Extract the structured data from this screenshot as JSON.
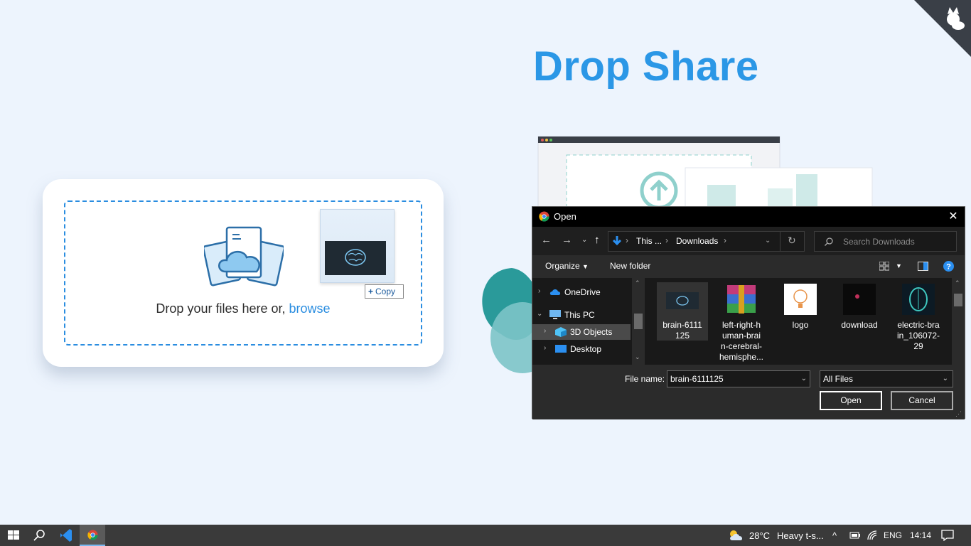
{
  "app": {
    "title": "Drop Share"
  },
  "dropzone": {
    "prompt": "Drop your files here or,",
    "browse_label": "browse",
    "drag_badge": "Copy"
  },
  "dialog": {
    "title": "Open",
    "breadcrumb": [
      "This ...",
      "Downloads"
    ],
    "search_placeholder": "Search Downloads",
    "toolbar": {
      "organize": "Organize",
      "new_folder": "New folder"
    },
    "nav_items": [
      {
        "label": "OneDrive",
        "icon": "cloud-icon"
      },
      {
        "label": "This PC",
        "icon": "computer-icon"
      },
      {
        "label": "3D Objects",
        "icon": "cube-icon"
      },
      {
        "label": "Desktop",
        "icon": "desktop-icon"
      }
    ],
    "files": [
      {
        "name_lines": [
          "brain-6111",
          "125"
        ],
        "icon": "brain-image-thumbnail"
      },
      {
        "name_lines": [
          "left-right-h",
          "uman-brai",
          "n-cerebral-",
          "hemisphe..."
        ],
        "icon": "winrar-archive-icon"
      },
      {
        "name_lines": [
          "logo"
        ],
        "icon": "logo-image-thumbnail"
      },
      {
        "name_lines": [
          "download"
        ],
        "icon": "dark-image-thumbnail"
      },
      {
        "name_lines": [
          "electric-bra",
          "in_106072-",
          "29"
        ],
        "icon": "electric-brain-thumbnail"
      }
    ],
    "file_name_label": "File name:",
    "file_name_value": "brain-6111125",
    "file_type_value": "All Files",
    "open_label": "Open",
    "cancel_label": "Cancel"
  },
  "taskbar": {
    "temperature": "28°C",
    "weather": "Heavy t-s...",
    "language": "ENG",
    "time": "14:14"
  },
  "colors": {
    "accent": "#2b97e6",
    "dialog_bg": "#2b2b2b",
    "page_bg": "#edf4fd"
  }
}
